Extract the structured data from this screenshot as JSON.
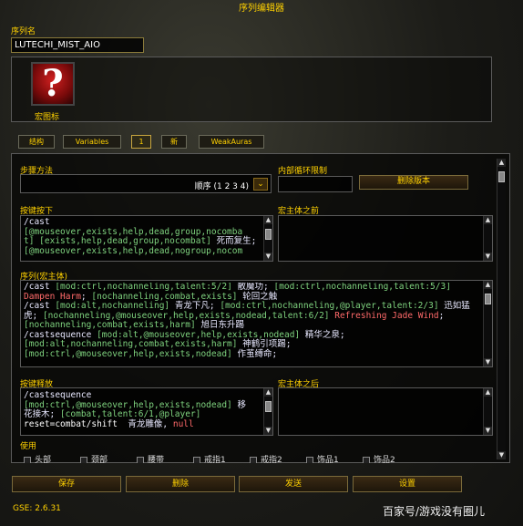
{
  "window": {
    "title": "序列编辑器"
  },
  "sequence": {
    "name_label": "序列名",
    "name_value": "LUTECHI_MIST_AIO",
    "icon_label": "宏图标"
  },
  "tabs": [
    {
      "label": "结构"
    },
    {
      "label": "Variables"
    },
    {
      "label": "1"
    },
    {
      "label": "新"
    },
    {
      "label": "WeakAuras"
    }
  ],
  "step": {
    "label": "步骤方法",
    "value": "顺序 (1 2 3 4)"
  },
  "loop": {
    "label": "内部循环限制",
    "value": ""
  },
  "delete_version_label": "删除版本",
  "keypress": {
    "label": "按键按下",
    "lines": [
      [
        [
          "cw",
          "/cast"
        ]
      ],
      [
        [
          "cg",
          "[@mouseover,exists,help,dead,group,nocomba"
        ]
      ],
      [
        [
          "cg",
          "t] [exists,help,dead,group,nocombat]"
        ],
        [
          "cw",
          " 死而复生;"
        ]
      ],
      [
        [
          "cg",
          "[@mouseover,exists,help,dead,nogroup,nocom"
        ]
      ]
    ]
  },
  "pre_macro": {
    "label": "宏主体之前"
  },
  "sequence_body": {
    "label": "序列(宏主体)",
    "lines": [
      [
        [
          "cw",
          "/cast "
        ],
        [
          "cg",
          "[mod:ctrl,nochanneling,talent:5/2]"
        ],
        [
          "cw",
          " 散魔功; "
        ],
        [
          "cg",
          "[mod:ctrl,nochanneling,talent:5/3]"
        ]
      ],
      [
        [
          "cr",
          "Dampen Harm"
        ],
        [
          "cw",
          "; "
        ],
        [
          "cg",
          "[nochanneling,combat,exists]"
        ],
        [
          "cw",
          " 轮回之触"
        ]
      ],
      [
        [
          "cw",
          "/cast "
        ],
        [
          "cg",
          "[mod:alt,nochanneling]"
        ],
        [
          "cw",
          " 青龙下凡; "
        ],
        [
          "cg",
          "[mod:ctrl,nochanneling,@player,talent:2/3]"
        ],
        [
          "cw",
          " 迅如猛"
        ]
      ],
      [
        [
          "cw",
          "虎; "
        ],
        [
          "cg",
          "[nochanneling,@mouseover,help,exists,nodead,talent:6/2]"
        ],
        [
          "cw",
          " "
        ],
        [
          "cr",
          "Refreshing Jade Wind"
        ],
        [
          "cw",
          ";"
        ]
      ],
      [
        [
          "cg",
          "[nochanneling,combat,exists,harm]"
        ],
        [
          "cw",
          " 旭日东升踢"
        ]
      ],
      [
        [
          "cw",
          "/castsequence "
        ],
        [
          "cg",
          "[mod:alt,@mouseover,help,exists,nodead]"
        ],
        [
          "cw",
          " 精华之泉;"
        ]
      ],
      [
        [
          "cg",
          "[mod:alt,nochanneling,combat,exists,harm]"
        ],
        [
          "cw",
          " 神鹤引项踢;"
        ]
      ],
      [
        [
          "cg",
          "[mod:ctrl,@mouseover,help,exists,nodead]"
        ],
        [
          "cw",
          " 作茧缚命;"
        ]
      ]
    ]
  },
  "keyrelease": {
    "label": "按键释放",
    "lines": [
      [
        [
          "cw",
          "/castsequence"
        ]
      ],
      [
        [
          "cg",
          "[mod:ctrl,@mouseover,help,exists,nodead]"
        ],
        [
          "cw",
          " 移"
        ]
      ],
      [
        [
          "cw",
          "花接木; "
        ],
        [
          "cg",
          "[combat,talent:6/1,@player]"
        ]
      ],
      [
        [
          "cy",
          "reset=combat/shift  "
        ],
        [
          "cw",
          "青龙雕像, "
        ],
        [
          "cr",
          "null"
        ]
      ]
    ]
  },
  "post_macro": {
    "label": "宏主体之后"
  },
  "use": {
    "label": "使用",
    "items": [
      "头部",
      "颈部",
      "腰带",
      "戒指1",
      "戒指2",
      "饰品1",
      "饰品2"
    ]
  },
  "buttons": {
    "save": "保存",
    "delete": "删除",
    "send": "发送",
    "settings": "设置"
  },
  "version": "GSE: 2.6.31",
  "watermark": "百家号/游戏没有圈儿"
}
